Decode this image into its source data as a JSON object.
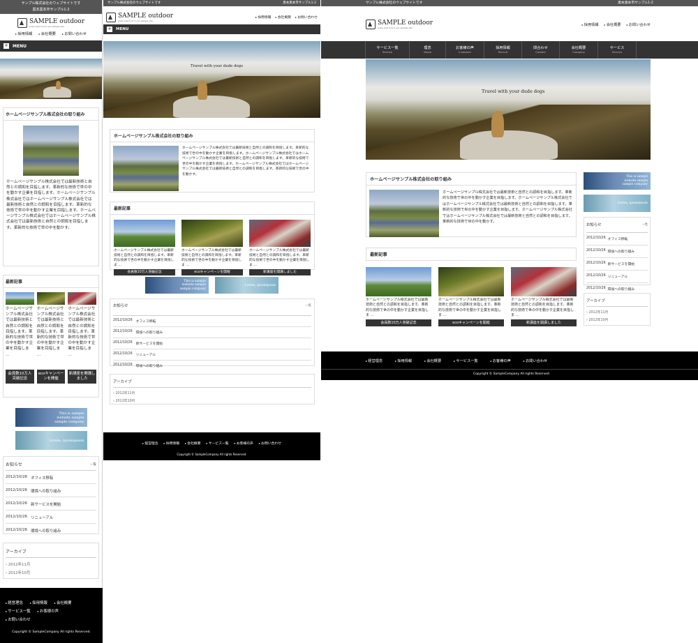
{
  "site": {
    "topbar_left": "サンプル株式会社のウェブサイトです",
    "topbar_right": "黒本黒本市サンプル1-2",
    "logo_text": "SAMPLE outdoor",
    "logo_sub": "some tent tour it sel, sample site",
    "menu_label": "MENU",
    "header_nav": [
      "採用情報",
      "会社概要",
      "お問い合わせ"
    ]
  },
  "global_nav": [
    {
      "label": "サービス一覧",
      "sub": "Service"
    },
    {
      "label": "理念",
      "sub": "Vision"
    },
    {
      "label": "お客様の声",
      "sub": "Customer"
    },
    {
      "label": "採用情報",
      "sub": "Recruit"
    },
    {
      "label": "問合わせ",
      "sub": "Contact"
    },
    {
      "label": "会社概要",
      "sub": "Company"
    },
    {
      "label": "サービス",
      "sub": "Service"
    }
  ],
  "hero": {
    "caption": "Travel with your dude dogs"
  },
  "about": {
    "heading": "ホームページサンプル株式会社の取り組み",
    "body": "ホームページサンプル株式会社では最新技術と自然との調和を目指します。革新的な技術で世の中を動かす企業を目指します。ホームページサンプル株式会社ではホームページサンプル株式会社では最新技術と自然との調和を目指します。革新的な技術で世の中を動かす企業を目指します。ホームページサンプル株式会社ではホームページサンプル株式会社では最新技術と自然との調和を目指します。革新的な技術で世の中を動かす。"
  },
  "articles": {
    "heading": "最新記事",
    "excerpt": "ホームページサンプル株式会社では最新技術と自然との調和を目指します。革新的な技術で世の中を動かす企業を目指しま …",
    "excerpt_short": "ホームページサンプル株式会社では最新技術と自然との調和を目指します。革新的な技術で世の中を動かす企業を目指しま …",
    "buttons": [
      "会員数10万人突破記念",
      "ecoキャンペーンを開催",
      "新講座を開講しました"
    ],
    "buttons_narrow": [
      "会員数10万人突破記念",
      "ecoキャンペーンを開催",
      "新講座を開講しました"
    ]
  },
  "banners": {
    "b1_l1": "This is sample",
    "b1_l2": "website sample",
    "b1_l3": "sample company",
    "b2": "Lorem, ipsumipsum"
  },
  "news": {
    "heading": "お知らせ",
    "list_link": "一覧",
    "items": [
      {
        "date": "2012/10/26",
        "title": "オフィス移転"
      },
      {
        "date": "2012/10/26",
        "title": "環境への取り組み"
      },
      {
        "date": "2012/10/26",
        "title": "新サービスを開始"
      },
      {
        "date": "2012/10/26",
        "title": "リニューアル"
      },
      {
        "date": "2012/10/26",
        "title": "環境への取り組み"
      }
    ]
  },
  "archive": {
    "heading": "アーカイブ",
    "items": [
      "2012年11月",
      "2012年10月"
    ]
  },
  "footer": {
    "nav": [
      "経営理念",
      "採用情報",
      "会社概要",
      "サービス一覧",
      "お客様の声",
      "お問い合わせ"
    ],
    "copyright": "Copyright © SampleCompany All rights Reserved."
  },
  "colors": {
    "dark": "#333333",
    "topbar": "#555555",
    "footer": "#000000"
  }
}
